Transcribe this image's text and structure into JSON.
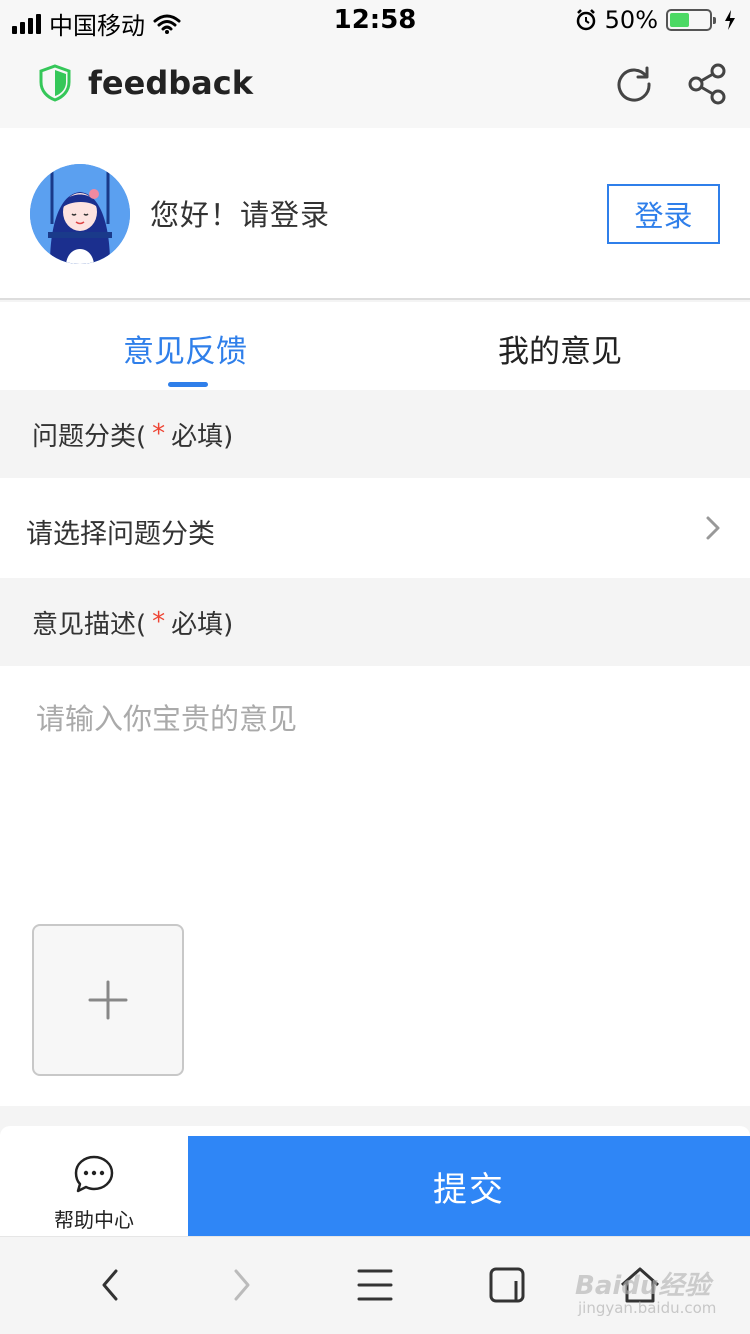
{
  "status_bar": {
    "carrier": "中国移动",
    "time": "12:58",
    "battery": "50%",
    "battery_level": 0.5,
    "icons": [
      "signal-icon",
      "wifi-icon",
      "alarm-icon",
      "battery-icon",
      "charging-icon"
    ]
  },
  "title_bar": {
    "title": "feedback",
    "icons": [
      "shield-icon",
      "refresh-icon",
      "share-icon"
    ]
  },
  "user": {
    "greeting": "您好！请登录",
    "login_label": "登录"
  },
  "tabs": [
    {
      "label": "意见反馈",
      "active": true
    },
    {
      "label": "我的意见",
      "active": false
    }
  ],
  "form": {
    "category_header": "问题分类(",
    "category_required": "*",
    "category_header_suffix": "必填)",
    "category_placeholder": "请选择问题分类",
    "desc_header": "意见描述(",
    "desc_required": "*",
    "desc_header_suffix": "必填)",
    "desc_placeholder": "请输入你宝贵的意见"
  },
  "bottom": {
    "help_label": "帮助中心",
    "submit_label": "提交"
  },
  "browser_nav": {
    "icons": [
      "back-icon",
      "forward-icon",
      "menu-icon",
      "tabs-icon",
      "home-icon"
    ]
  },
  "watermark": {
    "text": "Baidu经验",
    "url": "jingyan.baidu.com"
  },
  "colors": {
    "accent": "#2f7fea",
    "submit": "#2f86f6",
    "required": "#ee4433",
    "battery": "#4cd964",
    "shield": "#35c759"
  }
}
